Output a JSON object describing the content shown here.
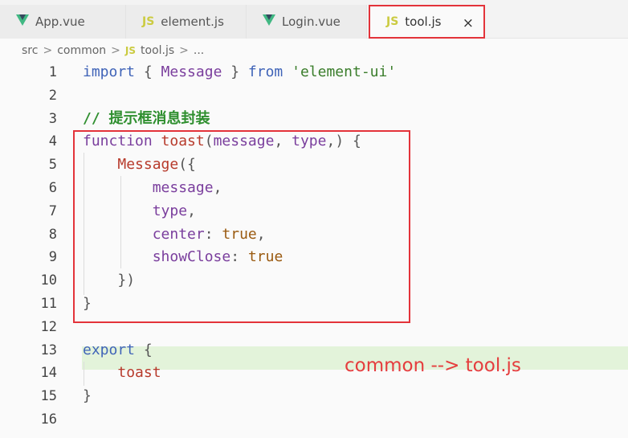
{
  "tabs": [
    {
      "label": "App.vue",
      "icon": "vue-icon"
    },
    {
      "label": "element.js",
      "icon": "js-icon",
      "icon_text": "JS"
    },
    {
      "label": "Login.vue",
      "icon": "vue-icon"
    },
    {
      "label": "tool.js",
      "icon": "js-icon",
      "icon_text": "JS",
      "active": true,
      "close": "×"
    }
  ],
  "breadcrumb": {
    "parts": [
      "src",
      "common"
    ],
    "file_icon": "JS",
    "file": "tool.js",
    "trailing": "..."
  },
  "separator": ">",
  "lines": [
    {
      "n": "1"
    },
    {
      "n": "2"
    },
    {
      "n": "3"
    },
    {
      "n": "4"
    },
    {
      "n": "5"
    },
    {
      "n": "6"
    },
    {
      "n": "7"
    },
    {
      "n": "8"
    },
    {
      "n": "9"
    },
    {
      "n": "10"
    },
    {
      "n": "11"
    },
    {
      "n": "12"
    },
    {
      "n": "13"
    },
    {
      "n": "14"
    },
    {
      "n": "15"
    },
    {
      "n": "16"
    }
  ],
  "code": {
    "l1": {
      "import": "import",
      "open": " { ",
      "name": "Message",
      "close": " } ",
      "from": "from",
      "sp": " ",
      "src": "'element-ui'"
    },
    "l3": {
      "comment": "// 提示框消息封装"
    },
    "l4": {
      "function": "function",
      "sp": " ",
      "name": "toast",
      "p1": "(",
      "a1": "message",
      "c1": ", ",
      "a2": "type",
      "rest": ",) {"
    },
    "l5": {
      "indent": "    ",
      "name": "Message",
      "rest": "({"
    },
    "l6": {
      "indent": "        ",
      "id": "message",
      "rest": ","
    },
    "l7": {
      "indent": "        ",
      "id": "type",
      "rest": ","
    },
    "l8": {
      "indent": "        ",
      "key": "center",
      "colon": ": ",
      "val": "true",
      "rest": ","
    },
    "l9": {
      "indent": "        ",
      "key": "showClose",
      "colon": ": ",
      "val": "true"
    },
    "l10": {
      "indent": "    ",
      "rest": "})"
    },
    "l11": {
      "rest": "}"
    },
    "l13": {
      "export": "export",
      "rest": " {"
    },
    "l14": {
      "indent": "    ",
      "id": "toast"
    },
    "l15": {
      "rest": "}"
    }
  },
  "annotation": "common --> tool.js",
  "colors": {
    "highlight_box": "#e3333a",
    "note": "#e53d3d",
    "current_line": "#e3f3da"
  }
}
